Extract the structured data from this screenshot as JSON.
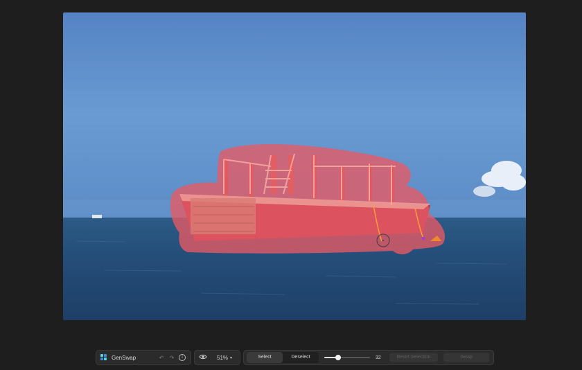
{
  "app": {
    "name": "GenSwap"
  },
  "view": {
    "zoom": "51%"
  },
  "tools": {
    "select_label": "Select",
    "deselect_label": "Deselect",
    "active_mode": "Select",
    "brush_size": "32",
    "brush_level": 0.3,
    "reset_label": "Reset Selection",
    "swap_label": "Swap"
  },
  "colors": {
    "background": "#1e1e1e",
    "selection_mask": "#e85a64",
    "toolbar": "#2b2b2b"
  },
  "icons": {
    "undo": "undo-icon",
    "redo": "redo-icon",
    "info": "info-icon",
    "visibility": "eye-icon",
    "zoom_menu": "chevron-down-icon"
  }
}
